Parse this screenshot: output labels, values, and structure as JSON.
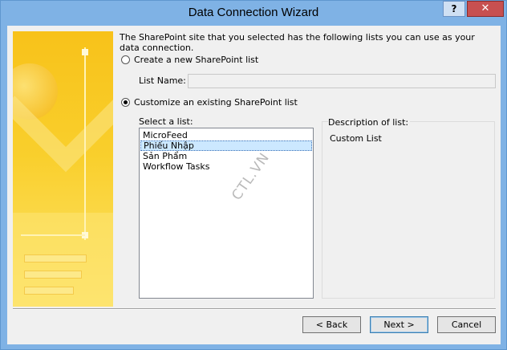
{
  "window": {
    "title": "Data Connection Wizard",
    "help_label": "?",
    "close_label": "✕"
  },
  "intro_text": "The SharePoint site that you selected has the following lists you can use as your data connection.",
  "options": {
    "create_new_label": "Create a new SharePoint list",
    "list_name_label": "List Name:",
    "list_name_value": "",
    "customize_label": "Customize an existing SharePoint list",
    "selected": "customize"
  },
  "select_list": {
    "label": "Select a list:",
    "items": [
      "MicroFeed",
      "Phiếu Nhập",
      "Sản Phẩm",
      "Workflow Tasks"
    ],
    "selected_index": 1
  },
  "description": {
    "label": "Description of list:",
    "text": "Custom List"
  },
  "buttons": {
    "back": "< Back",
    "next": "Next >",
    "cancel": "Cancel"
  },
  "watermark": "CTL.VN",
  "colors": {
    "frame": "#7fb2e5",
    "close": "#c75050",
    "selection": "#cce8ff",
    "banner": "#f9cf2c"
  }
}
